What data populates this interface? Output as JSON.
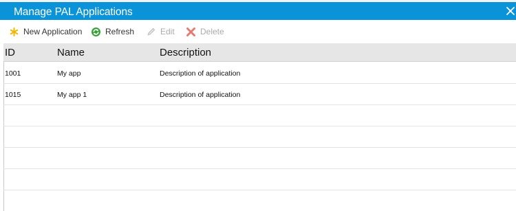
{
  "dialog": {
    "title": "Manage PAL Applications"
  },
  "toolbar": {
    "new_label": "New Application",
    "refresh_label": "Refresh",
    "edit_label": "Edit",
    "delete_label": "Delete"
  },
  "grid": {
    "columns": [
      "ID",
      "Name",
      "Description"
    ],
    "rows": [
      {
        "id": "1001",
        "name": "My app",
        "description": "Description of application"
      },
      {
        "id": "1015",
        "name": "My app 1",
        "description": "Description of application"
      }
    ]
  },
  "colors": {
    "titlebar": "#0a93d8",
    "header_bg": "#e6e6e6",
    "new_icon": "#f5b400",
    "refresh_icon": "#3aa13a",
    "delete_icon": "#e05a4a"
  }
}
